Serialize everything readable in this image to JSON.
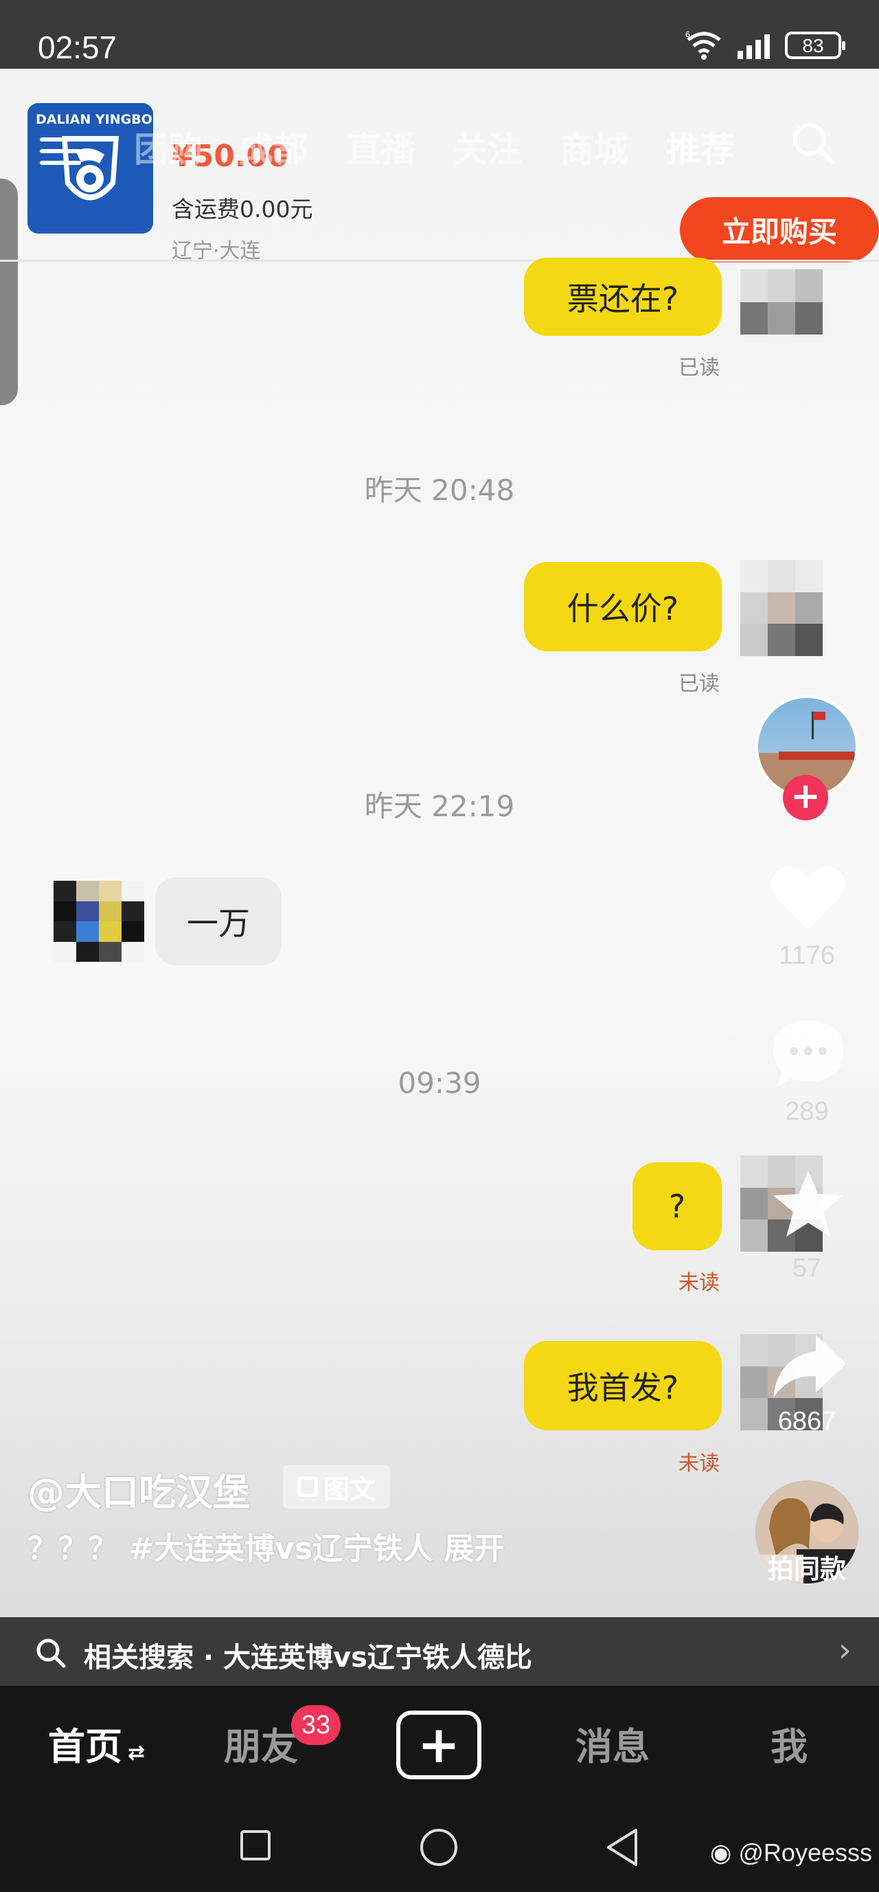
{
  "status_bar": {
    "time": "02:57",
    "battery": "83",
    "network": "6"
  },
  "top_nav": {
    "tabs": [
      "团购",
      "成都",
      "直播",
      "关注",
      "商城",
      "推荐"
    ],
    "active_tab": "推荐"
  },
  "product": {
    "logo_text": "DALIAN YINGBO",
    "price": "¥50.00",
    "shipping": "含运费0.00元",
    "location": "辽宁·大连",
    "buy_label": "立即购买"
  },
  "chat": {
    "messages": [
      {
        "text": "票还在?",
        "status": "已读"
      },
      {
        "timestamp": "昨天 20:48"
      },
      {
        "text": "什么价?",
        "status": "已读"
      },
      {
        "timestamp": "昨天 22:19"
      },
      {
        "text": "一万",
        "incoming": true
      },
      {
        "timestamp": "09:39"
      },
      {
        "text": "?",
        "status": "未读"
      },
      {
        "text": "我首发?",
        "status": "未读"
      }
    ]
  },
  "rail": {
    "likes": "1176",
    "comments": "289",
    "favorites": "57",
    "shares": "6867",
    "same_label": "拍同款"
  },
  "caption": {
    "author": "@大口吃汉堡",
    "badge": "图文",
    "description": "？？？ #大连英博vs辽宁铁人  展开"
  },
  "related_search": {
    "text": "相关搜索 · 大连英博vs辽宁铁人德比"
  },
  "bottom_nav": {
    "home": "首页",
    "friends": "朋友",
    "friends_badge": "33",
    "messages": "消息",
    "me": "我"
  },
  "watermark": "@Royeesss"
}
